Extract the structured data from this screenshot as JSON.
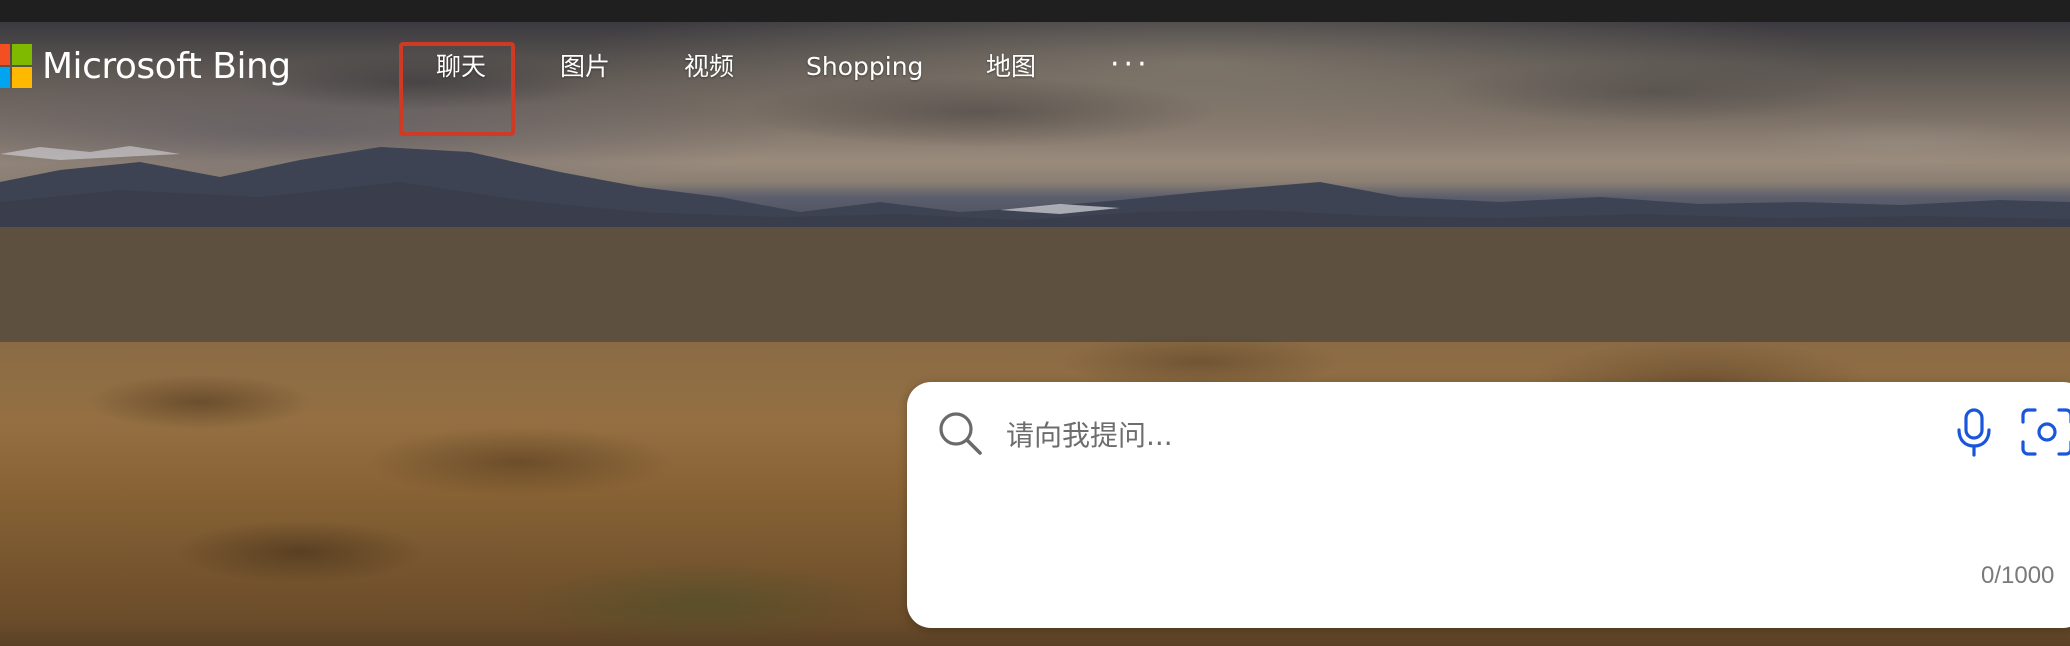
{
  "brand": {
    "name": "Microsoft Bing",
    "logo_colors": [
      "#f25022",
      "#7fba00",
      "#00a4ef",
      "#ffb900"
    ]
  },
  "nav": {
    "items": [
      {
        "label": "聊天",
        "highlighted": true
      },
      {
        "label": "图片"
      },
      {
        "label": "视频"
      },
      {
        "label": "Shopping"
      },
      {
        "label": "地图"
      }
    ],
    "more_label": "···",
    "highlight_color": "#d03a24"
  },
  "search": {
    "placeholder": "请向我提问...",
    "value": "",
    "char_count": "0/1000",
    "search_icon": "search-icon",
    "mic_icon": "microphone-icon",
    "visual_search_icon": "visual-search-icon",
    "accent_color": "#1a56db"
  },
  "background": {
    "theme": "mountain landscape at dusk"
  }
}
